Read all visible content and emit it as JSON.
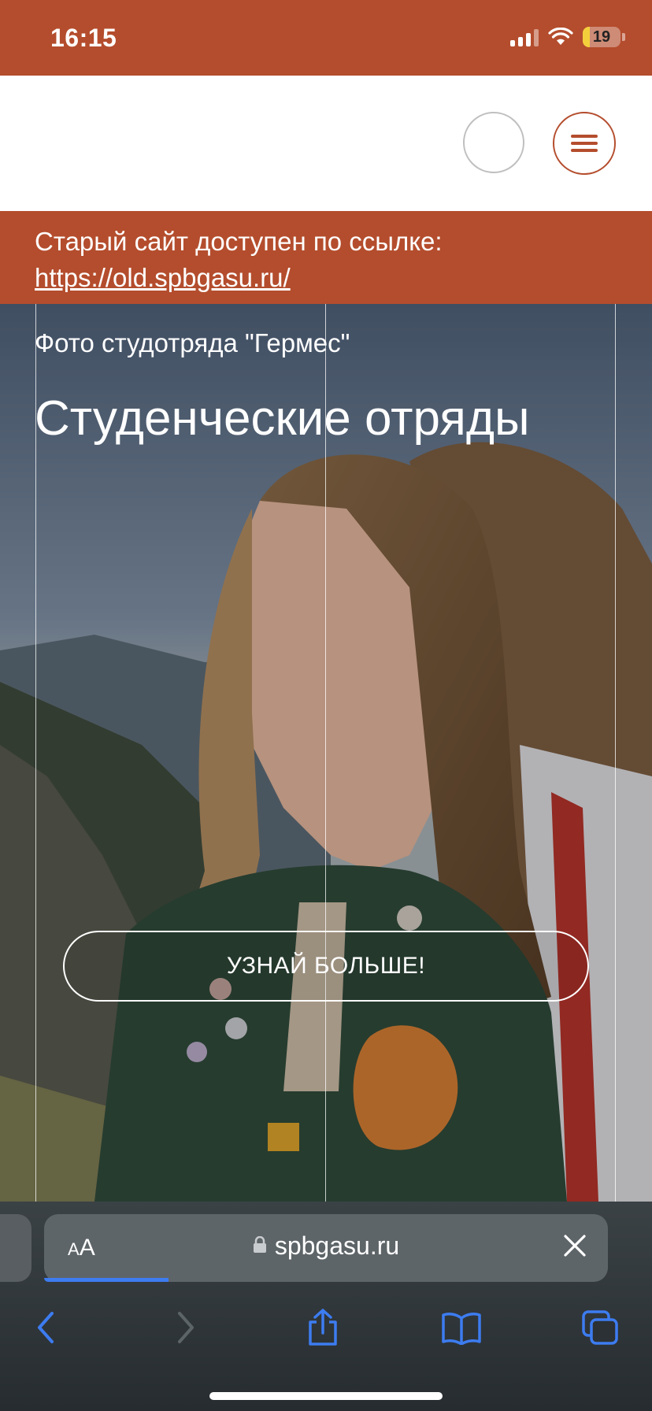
{
  "status_bar": {
    "time": "16:15",
    "battery": "19",
    "battery_level": 0.19,
    "signal_bars": 3
  },
  "header": {
    "search_button": "",
    "menu_icon": "hamburger-menu-icon"
  },
  "notice": {
    "text": "Старый сайт доступен по ссылке:",
    "link": "https://old.spbgasu.ru/"
  },
  "hero": {
    "caption": "Фото студотряда \"Гермес\"",
    "title": "Студенческие отряды",
    "button_label": "УЗНАЙ БОЛЬШЕ!"
  },
  "browser": {
    "text_size_label": "AA",
    "domain": "spbgasu.ru",
    "load_progress": 0.22
  },
  "colors": {
    "brand": "#b44d2d",
    "accent_blue": "#3d7cf1",
    "battery_yellow": "#f4cf3c"
  },
  "icons": {
    "back": "chevron-left-icon",
    "forward": "chevron-right-icon",
    "share": "share-icon",
    "bookmarks": "book-icon",
    "tabs": "tabs-icon",
    "lock": "lock-icon",
    "close": "close-icon"
  }
}
